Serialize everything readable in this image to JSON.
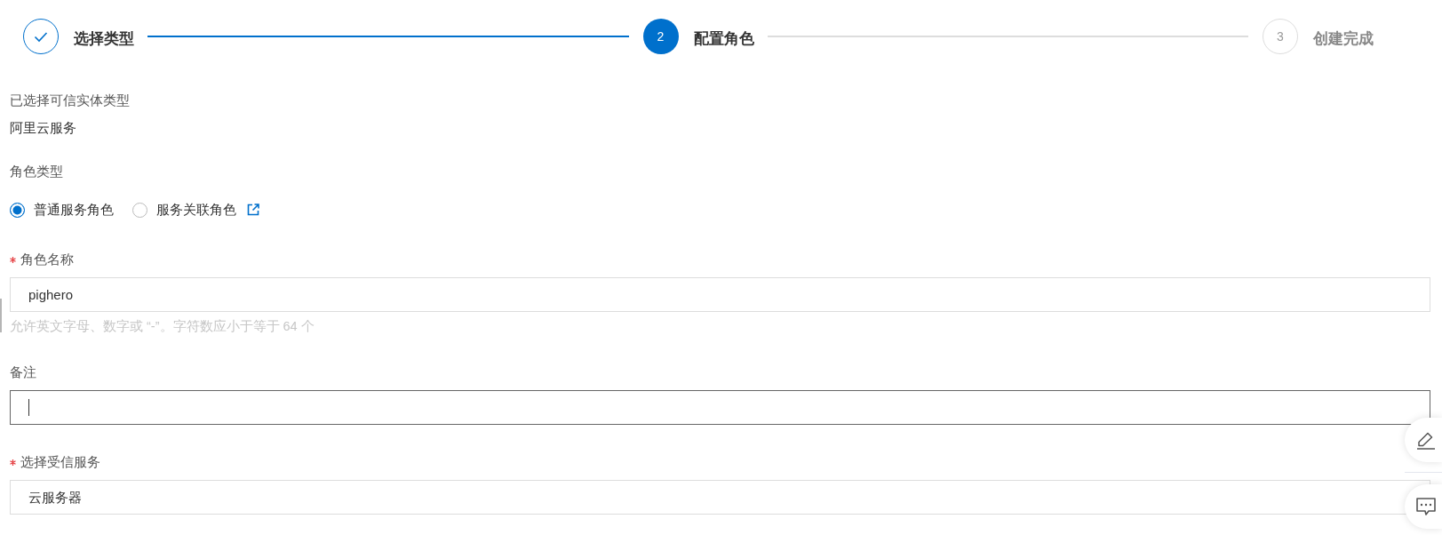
{
  "steps": [
    {
      "label": "选择类型",
      "done": true,
      "selected": false
    },
    {
      "number": "2",
      "label": "配置角色",
      "done": false,
      "selected": true
    },
    {
      "number": "3",
      "label": "创建完成",
      "done": false,
      "selected": false
    }
  ],
  "trusted_entity": {
    "label": "已选择可信实体类型",
    "value": "阿里云服务"
  },
  "role_type": {
    "label": "角色类型",
    "options": [
      {
        "label": "普通服务角色",
        "selected": true,
        "has_link": false
      },
      {
        "label": "服务关联角色",
        "selected": false,
        "has_link": true
      }
    ]
  },
  "fields": [
    {
      "label": "角色名称",
      "required": true,
      "focused": false,
      "value": "pighero",
      "hint": "允许英文字母、数字或 “-”。字符数应小于等于 64 个"
    },
    {
      "label": "备注",
      "required": false,
      "focused": true
    },
    {
      "label": "选择受信服务",
      "required": true,
      "focused": false,
      "value": "云服务器"
    }
  ]
}
